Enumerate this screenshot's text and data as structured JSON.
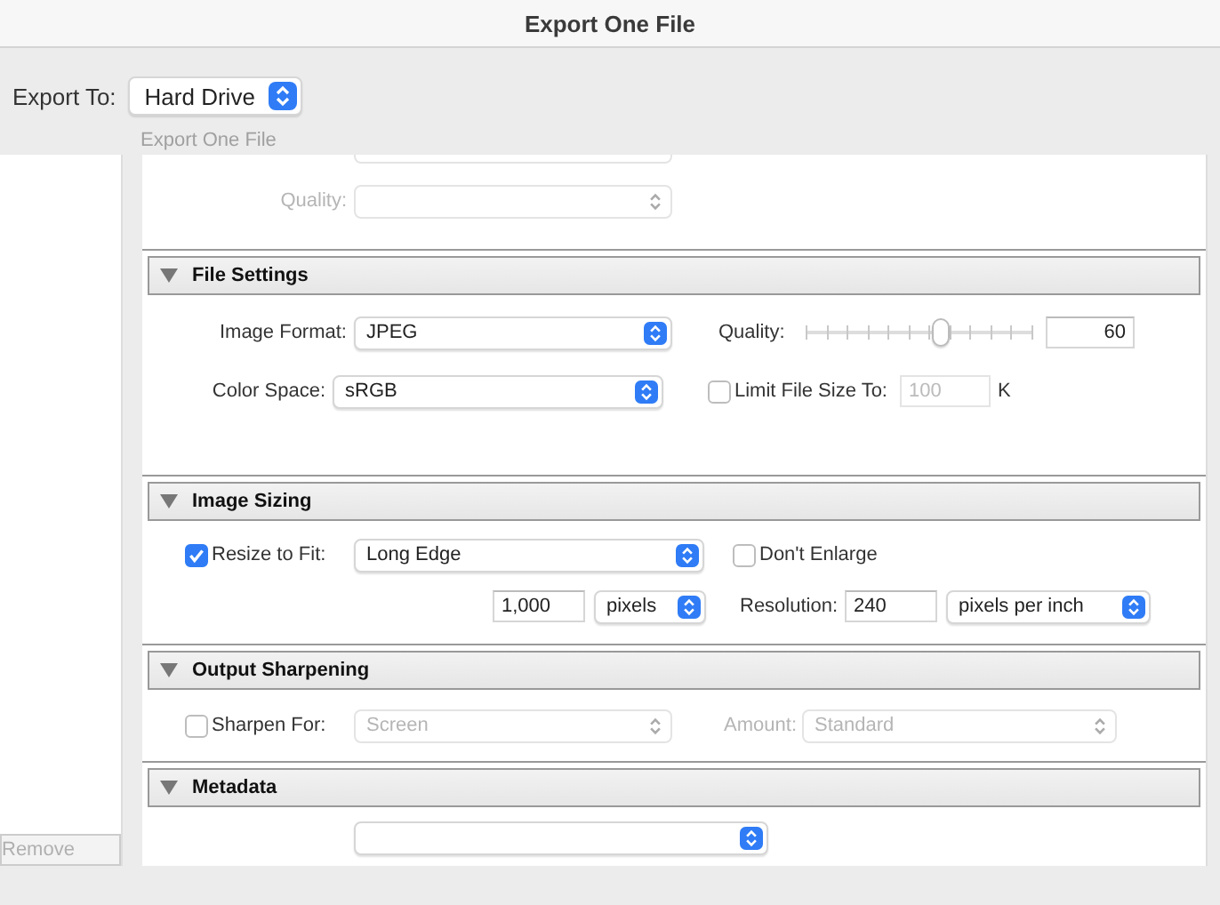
{
  "window": {
    "title": "Export One File"
  },
  "export_to": {
    "label": "Export To:",
    "value": "Hard Drive"
  },
  "preset_caption": "Export One File",
  "remove_button": {
    "label": "Remove",
    "disabled": true
  },
  "previous_section": {
    "quality": {
      "label": "Quality:",
      "disabled": true
    }
  },
  "file_settings": {
    "title": "File Settings",
    "expanded": true,
    "image_format": {
      "label": "Image Format:",
      "value": "JPEG"
    },
    "quality": {
      "label": "Quality:",
      "level": 0.6,
      "value": "60"
    },
    "color_space": {
      "label": "Color Space:",
      "value": "sRGB"
    },
    "limit_file_size": {
      "label": "Limit File Size To:",
      "checked": false,
      "value": "100",
      "disabled": true,
      "unit": "K"
    }
  },
  "image_sizing": {
    "title": "Image Sizing",
    "expanded": true,
    "resize_to_fit": {
      "label": "Resize to Fit:",
      "checked": true,
      "value": "Long Edge"
    },
    "dont_enlarge": {
      "label": "Don't Enlarge",
      "checked": false
    },
    "size": {
      "value": "1,000",
      "unit": "pixels"
    },
    "resolution": {
      "label": "Resolution:",
      "value": "240",
      "unit": "pixels per inch"
    }
  },
  "output_sharpening": {
    "title": "Output Sharpening",
    "expanded": true,
    "sharpen_for": {
      "label": "Sharpen For:",
      "checked": false,
      "value": "Screen",
      "disabled": true
    },
    "amount": {
      "label": "Amount:",
      "value": "Standard",
      "disabled": true
    }
  },
  "metadata": {
    "title": "Metadata",
    "expanded": true
  }
}
